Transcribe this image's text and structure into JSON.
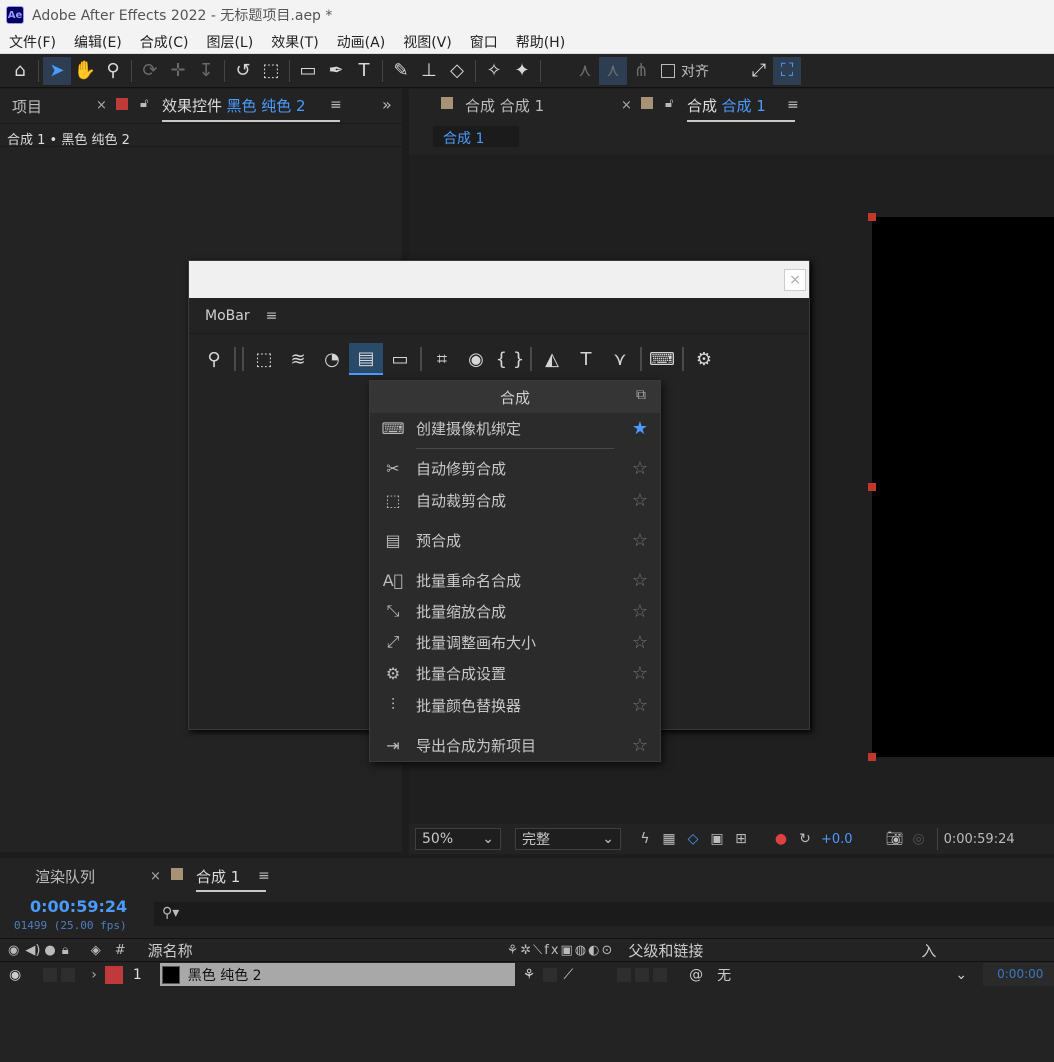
{
  "window": {
    "logo": "Ae",
    "title": "Adobe After Effects 2022 - 无标题项目.aep *"
  },
  "menu": [
    "文件(F)",
    "编辑(E)",
    "合成(C)",
    "图层(L)",
    "效果(T)",
    "动画(A)",
    "视图(V)",
    "窗口",
    "帮助(H)"
  ],
  "toolbar": {
    "align_label": "对齐"
  },
  "left_panel": {
    "project_tab": "项目",
    "effects_tab_prefix": "效果控件",
    "effects_tab_layer": "黑色 纯色 2",
    "breadcrumb": "合成 1 • 黑色 纯色 2"
  },
  "viewer": {
    "tab1_prefix": "合成",
    "tab1_name": "合成 1",
    "tab2_prefix": "合成",
    "tab2_name": "合成 1",
    "comp_chip": "合成 1",
    "zoom": "50%",
    "quality": "完整",
    "exposure": "+0.0",
    "timecode": "0:00:59:24"
  },
  "mobar": {
    "title": "MoBar",
    "menu_icon": "hamburger-icon"
  },
  "dropdown": {
    "header": "合成",
    "items": [
      {
        "label": "创建摄像机绑定",
        "icon": "camera-rig-icon",
        "starred": true
      },
      {
        "label": "自动修剪合成",
        "icon": "auto-trim-icon",
        "starred": false
      },
      {
        "label": "自动裁剪合成",
        "icon": "auto-crop-icon",
        "starred": false
      },
      {
        "label": "预合成",
        "icon": "precompose-icon",
        "starred": false
      },
      {
        "label": "批量重命名合成",
        "icon": "batch-rename-icon",
        "starred": false
      },
      {
        "label": "批量缩放合成",
        "icon": "batch-scale-icon",
        "starred": false
      },
      {
        "label": "批量调整画布大小",
        "icon": "batch-canvas-icon",
        "starred": false
      },
      {
        "label": "批量合成设置",
        "icon": "batch-settings-icon",
        "starred": false
      },
      {
        "label": "批量颜色替换器",
        "icon": "batch-color-icon",
        "starred": false
      },
      {
        "label": "导出合成为新项目",
        "icon": "export-project-icon",
        "starred": false
      }
    ]
  },
  "timeline": {
    "render_tab": "渲染队列",
    "comp_tab": "合成 1",
    "timecode": "0:00:59:24",
    "frames": "01499 (25.00 fps)",
    "col_hash": "#",
    "col_source": "源名称",
    "col_parent": "父级和链接",
    "col_in": "入",
    "layer": {
      "num": "1",
      "name": "黑色 纯色 2",
      "parent": "无",
      "in": "0:00:00"
    },
    "label_color": "#c0393b"
  }
}
